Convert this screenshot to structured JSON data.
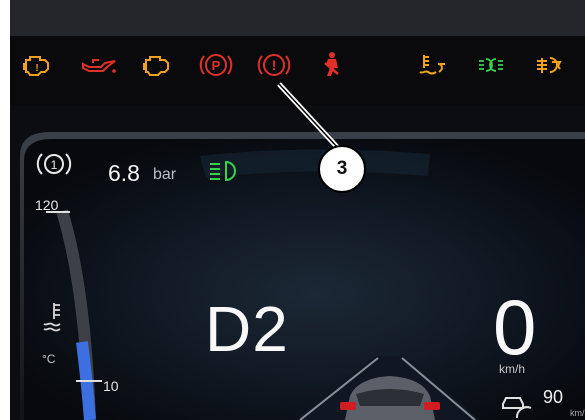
{
  "telltales": [
    {
      "icon": "check-engine-icon",
      "color": "#f0a21e"
    },
    {
      "icon": "oil-pressure-icon",
      "color": "#e0302a"
    },
    {
      "icon": "check-engine-icon",
      "color": "#f0a21e"
    },
    {
      "icon": "parking-brake-icon",
      "color": "#e0302a"
    },
    {
      "icon": "brake-warning-icon",
      "color": "#e0302a"
    },
    {
      "icon": "seatbelt-warning-icon",
      "color": "#e0302a"
    },
    {
      "icon": "coolant-level-icon",
      "color": "#f0a21e"
    },
    {
      "icon": "parking-lights-icon",
      "color": "#39d14a"
    },
    {
      "icon": "rear-fog-light-icon",
      "color": "#f0a21e"
    }
  ],
  "callout": {
    "label": "3"
  },
  "cluster": {
    "tire_pressure_value": "6.8",
    "tire_pressure_unit": "bar",
    "gauge_top_label": "120",
    "gauge_bottom_label": "10",
    "temperature_unit": "°C",
    "gear": "D2",
    "speed": "0",
    "speed_unit": "km/h",
    "cruise_speed": "90",
    "cruise_unit": "km/h",
    "coolant_level_fraction": 0.28
  },
  "colors": {
    "warning_red": "#e0302a",
    "amber": "#f0a21e",
    "green": "#39d14a",
    "gauge_blue": "#3c6fe0"
  }
}
